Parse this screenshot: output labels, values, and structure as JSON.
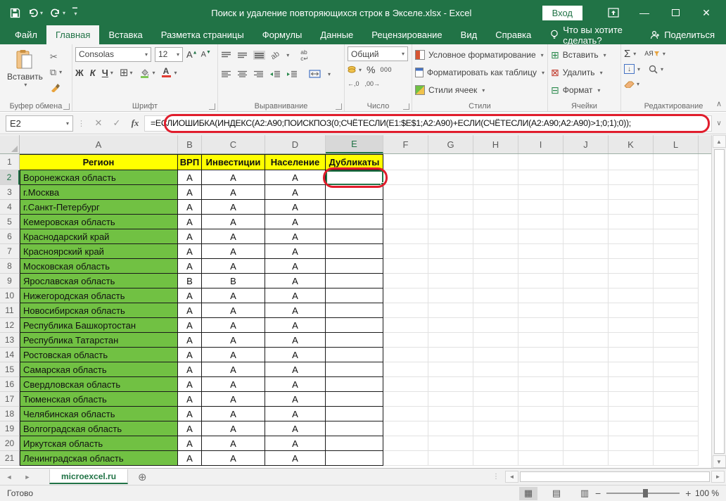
{
  "title_bar": {
    "title": "Поиск и удаление повторяющихся строк в Экселе.xlsx  -  Excel",
    "sign_in": "Вход"
  },
  "ribbon_tabs": [
    {
      "label": "Файл",
      "active": false
    },
    {
      "label": "Главная",
      "active": true
    },
    {
      "label": "Вставка",
      "active": false
    },
    {
      "label": "Разметка страницы",
      "active": false
    },
    {
      "label": "Формулы",
      "active": false
    },
    {
      "label": "Данные",
      "active": false
    },
    {
      "label": "Рецензирование",
      "active": false
    },
    {
      "label": "Вид",
      "active": false
    },
    {
      "label": "Справка",
      "active": false
    }
  ],
  "tell_me": "Что вы хотите сделать?",
  "share": "Поделиться",
  "ribbon": {
    "paste": "Вставить",
    "font_name": "Consolas",
    "font_size": "12",
    "bold": "Ж",
    "italic": "К",
    "underline": "Ч",
    "number_format": "Общий",
    "thousands": "000",
    "percent": "%",
    "inc_decimal": "←,0",
    "dec_decimal": ",00→",
    "wrap_top": "ab",
    "wrap_bottom": "c↵",
    "orientation": "ab",
    "cond_format": "Условное форматирование",
    "format_table": "Форматировать как таблицу",
    "cell_styles": "Стили ячеек",
    "insert": "Вставить",
    "delete": "Удалить",
    "format": "Формат",
    "sort_filter": "АЯ",
    "groups": {
      "clipboard": "Буфер обмена",
      "font": "Шрифт",
      "alignment": "Выравнивание",
      "number": "Число",
      "styles": "Стили",
      "cells": "Ячейки",
      "editing": "Редактирование"
    }
  },
  "formula_bar": {
    "name_box": "E2",
    "fx": "fx",
    "formula": "=ЕСЛИОШИБКА(ИНДЕКС(A2:A90;ПОИСКПОЗ(0;СЧЁТЕСЛИ(E1:$E$1;A2:A90)+ЕСЛИ(СЧЁТЕСЛИ(A2:A90;A2:A90)>1;0;1);0));"
  },
  "grid": {
    "columns": [
      "A",
      "B",
      "C",
      "D",
      "E",
      "F",
      "G",
      "H",
      "I",
      "J",
      "K",
      "L"
    ],
    "selected_column": "E",
    "selected_cell": "E2",
    "headers": [
      "Регион",
      "ВРП",
      "Инвестиции",
      "Население",
      "Дубликаты"
    ],
    "rows": [
      {
        "region": "Воронежская область",
        "vrp": "А",
        "inv": "А",
        "pop": "А",
        "dup": ""
      },
      {
        "region": "г.Москва",
        "vrp": "А",
        "inv": "А",
        "pop": "А",
        "dup": ""
      },
      {
        "region": "г.Санкт-Петербург",
        "vrp": "А",
        "inv": "А",
        "pop": "А",
        "dup": ""
      },
      {
        "region": "Кемеровская область",
        "vrp": "А",
        "inv": "А",
        "pop": "А",
        "dup": ""
      },
      {
        "region": "Краснодарский край",
        "vrp": "А",
        "inv": "А",
        "pop": "А",
        "dup": ""
      },
      {
        "region": "Красноярский край",
        "vrp": "А",
        "inv": "А",
        "pop": "А",
        "dup": ""
      },
      {
        "region": "Московская область",
        "vrp": "А",
        "inv": "А",
        "pop": "А",
        "dup": ""
      },
      {
        "region": "Ярославская область",
        "vrp": "В",
        "inv": "В",
        "pop": "А",
        "dup": ""
      },
      {
        "region": "Нижегородская область",
        "vrp": "А",
        "inv": "А",
        "pop": "А",
        "dup": ""
      },
      {
        "region": "Новосибирская область",
        "vrp": "А",
        "inv": "А",
        "pop": "А",
        "dup": ""
      },
      {
        "region": "Республика Башкортостан",
        "vrp": "А",
        "inv": "А",
        "pop": "А",
        "dup": ""
      },
      {
        "region": "Республика Татарстан",
        "vrp": "А",
        "inv": "А",
        "pop": "А",
        "dup": ""
      },
      {
        "region": "Ростовская область",
        "vrp": "А",
        "inv": "А",
        "pop": "А",
        "dup": ""
      },
      {
        "region": "Самарская область",
        "vrp": "А",
        "inv": "А",
        "pop": "А",
        "dup": ""
      },
      {
        "region": "Свердловская область",
        "vrp": "А",
        "inv": "А",
        "pop": "А",
        "dup": ""
      },
      {
        "region": "Тюменская область",
        "vrp": "А",
        "inv": "А",
        "pop": "А",
        "dup": ""
      },
      {
        "region": "Челябинская область",
        "vrp": "А",
        "inv": "А",
        "pop": "А",
        "dup": ""
      },
      {
        "region": "Волгоградская область",
        "vrp": "А",
        "inv": "А",
        "pop": "А",
        "dup": ""
      },
      {
        "region": "Иркутская область",
        "vrp": "А",
        "inv": "А",
        "pop": "А",
        "dup": ""
      },
      {
        "region": "Ленинградская область",
        "vrp": "А",
        "inv": "А",
        "pop": "А",
        "dup": ""
      }
    ]
  },
  "sheet_bar": {
    "tab": "microexcel.ru"
  },
  "status_bar": {
    "status": "Готово",
    "zoom": "100 %"
  },
  "icons": {
    "dropdown": "▾",
    "cut": "✂",
    "copy": "⧉",
    "borders": "⊞",
    "sum": "Σ",
    "cancel": "✕",
    "enter": "✓",
    "close": "✕",
    "minimize": "—",
    "dots": "⋮",
    "add-sheet": "⊕",
    "nav-left": "◄",
    "nav-right": "►",
    "scroll-up": "▲",
    "scroll-down": "▼",
    "view-normal": "▦",
    "view-layout": "▤",
    "view-break": "▥",
    "collapse": "∧",
    "expand-formula": "∨",
    "zoom-out": "−",
    "zoom-in": "+",
    "fill-down": "↓",
    "insert-cells": "⊞",
    "delete-cells": "⊠",
    "format-cells": "⊟"
  },
  "colors": {
    "brand_green": "#217346",
    "header_yellow": "#ffff00",
    "cell_green": "#71c143",
    "annotation_red": "#e01d2c"
  }
}
